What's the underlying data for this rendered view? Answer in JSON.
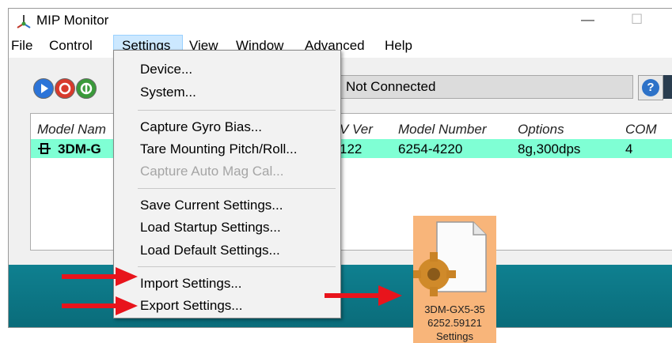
{
  "window": {
    "title": "MIP Monitor",
    "minimize_glyph": "—",
    "maximize_glyph": "☐"
  },
  "menubar": {
    "items": [
      "File",
      "Control",
      "Settings",
      "View",
      "Window",
      "Advanced",
      "Help"
    ]
  },
  "toolbar": {
    "buttons": [
      {
        "icon": "play-icon",
        "color": "#2c74d8"
      },
      {
        "icon": "stop-icon",
        "color": "#d83a2c"
      },
      {
        "icon": "record-icon",
        "color": "#3a9a3a"
      }
    ],
    "status": "Not Connected",
    "help_label": "?"
  },
  "device_list": {
    "columns": [
      "Model Nam",
      "V Ver",
      "Model Number",
      "Options",
      "COM"
    ],
    "rows": [
      {
        "model_name": "3DM-G",
        "fw_ver": "122",
        "model_number": "6254-4220",
        "options": "8g,300dps",
        "com": "4"
      }
    ]
  },
  "settings_menu": {
    "groups": [
      [
        {
          "label": "Device...",
          "enabled": true
        },
        {
          "label": "System...",
          "enabled": true
        }
      ],
      [
        {
          "label": "Capture Gyro Bias...",
          "enabled": true
        },
        {
          "label": "Tare Mounting Pitch/Roll...",
          "enabled": true
        },
        {
          "label": "Capture Auto Mag Cal...",
          "enabled": false
        }
      ],
      [
        {
          "label": "Save Current Settings...",
          "enabled": true
        },
        {
          "label": "Load Startup Settings...",
          "enabled": true
        },
        {
          "label": "Load Default Settings...",
          "enabled": true
        }
      ],
      [
        {
          "label": "Import Settings...",
          "enabled": true
        },
        {
          "label": "Export Settings...",
          "enabled": true
        }
      ]
    ]
  },
  "settings_file": {
    "caption_lines": [
      "3DM-GX5-35",
      "6252.59121",
      "Settings"
    ]
  },
  "colors": {
    "highlight_row": "#7fffd4",
    "menu_active": "#cce8ff",
    "teal_band": "#0f8090",
    "arrow": "#e8141c",
    "file_tile": "#f8b57a"
  }
}
